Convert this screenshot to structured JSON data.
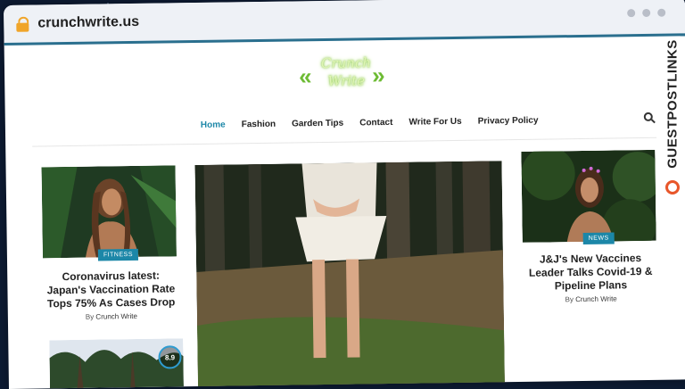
{
  "browser": {
    "url": "crunchwrite.us",
    "lock_icon": "lock-icon",
    "window_controls": [
      "dot",
      "dot",
      "dot"
    ]
  },
  "site": {
    "logo_text": "Crunch Write",
    "nav": [
      {
        "label": "Home",
        "active": true
      },
      {
        "label": "Fashion"
      },
      {
        "label": "Garden Tips"
      },
      {
        "label": "Contact"
      },
      {
        "label": "Write For Us"
      },
      {
        "label": "Privacy Policy"
      }
    ],
    "search_icon": "search-icon"
  },
  "posts": {
    "left_top": {
      "category": "FITNESS",
      "title": "Coronavirus latest: Japan's Vaccination Rate Tops 75% As Cases Drop",
      "by": "By",
      "author": "Crunch Write"
    },
    "left_bottom": {
      "score": "8.9"
    },
    "right_top": {
      "category": "NEWS",
      "title": "J&J's New Vaccines Leader Talks Covid-19 & Pipeline Plans",
      "by": "By",
      "author": "Crunch Write"
    }
  },
  "watermark": {
    "brand": "GUESTPOSTLINKS"
  },
  "colors": {
    "accent": "#1c87a8",
    "lock": "#f0a52a",
    "logo_green": "#6dbb34",
    "brand_orange": "#e8562a",
    "background": "#0d1b33"
  }
}
